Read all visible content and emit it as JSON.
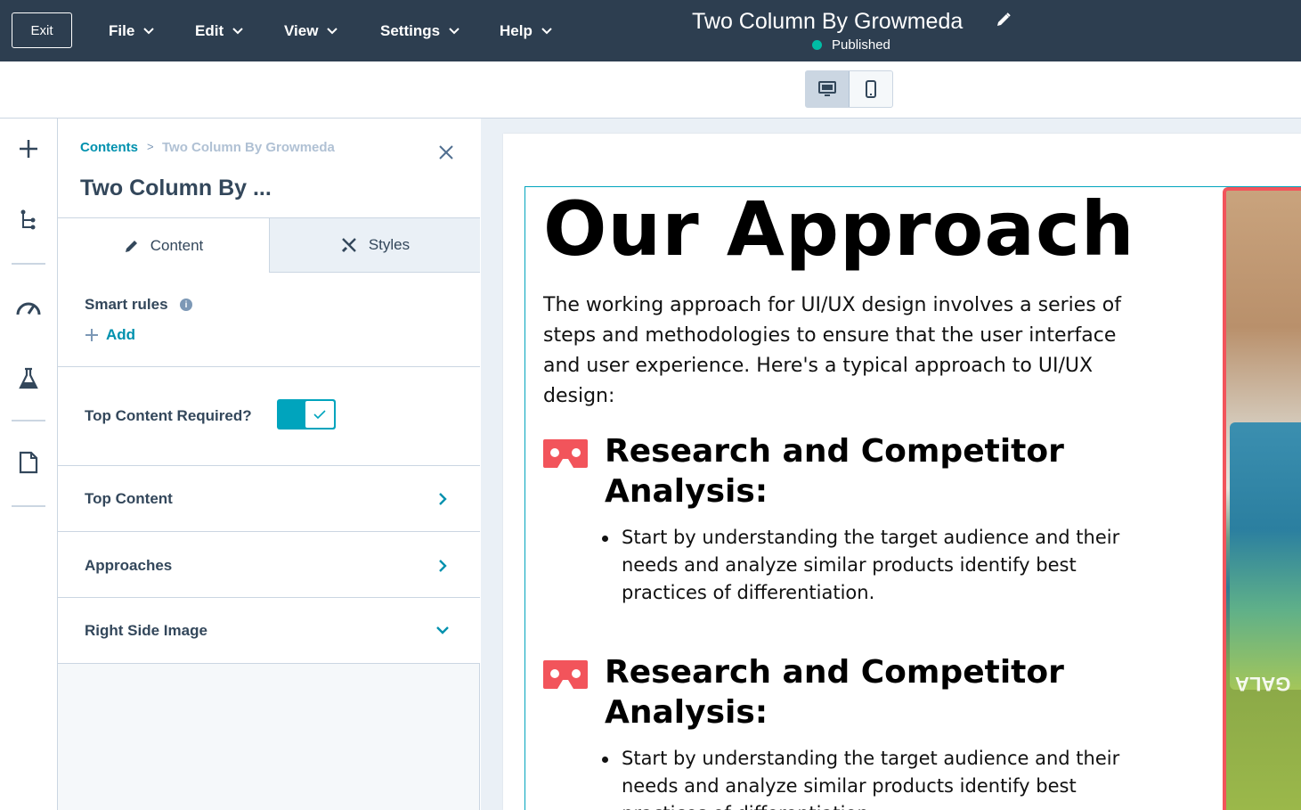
{
  "topbar": {
    "exit_label": "Exit",
    "menus": [
      "File",
      "Edit",
      "View",
      "Settings",
      "Help"
    ],
    "doc_title": "Two Column By Growmeda",
    "status": "Published",
    "status_color": "#00bda5"
  },
  "view_toggle": {
    "options": [
      "desktop-icon",
      "mobile-icon"
    ],
    "selected": "desktop"
  },
  "rail": {
    "icons": [
      "plus-icon",
      "tree-icon",
      "speedometer-icon",
      "flask-icon",
      "document-icon"
    ]
  },
  "panel": {
    "breadcrumb_root": "Contents",
    "breadcrumb_sep": ">",
    "breadcrumb_current": "Two Column By Growmeda",
    "title": "Two Column By ...",
    "tabs": [
      "Content",
      "Styles"
    ],
    "smart_rules_label": "Smart rules",
    "add_label": "Add",
    "top_content_required_label": "Top Content Required?",
    "top_content_required": true,
    "rows": [
      "Top Content",
      "Approaches",
      "Right Side Image"
    ]
  },
  "preview": {
    "heading": "Our Approach",
    "lead": "The working approach for UI/UX design involves a series of steps and methodologies to ensure that the user interface and user experience. Here's a typical approach to UI/UX design:",
    "approaches": [
      {
        "title": "Research and Competitor Analysis:",
        "bullet": "Start by understanding the target audience and their needs and analyze similar products identify best practices of differentiation."
      },
      {
        "title": "Research and Competitor Analysis:",
        "bullet": "Start by understanding the target audience and their needs and analyze similar products identify best practices of differentiation."
      }
    ],
    "accent_color": "#f2545b",
    "image_text": "GALA"
  }
}
